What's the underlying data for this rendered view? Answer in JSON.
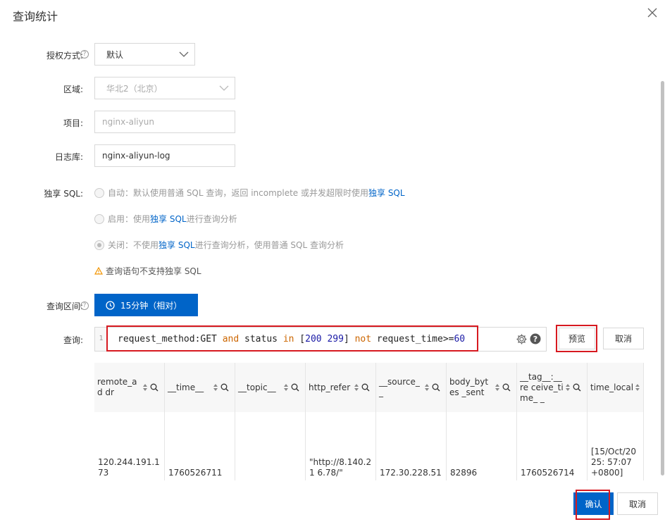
{
  "dialog": {
    "title": "查询统计"
  },
  "form": {
    "auth_label": "授权方式:",
    "auth_value": "默认",
    "region_label": "区域:",
    "region_value": "华北2（北京）",
    "project_label": "项目:",
    "project_value": "nginx-aliyun",
    "logstore_label": "日志库:",
    "logstore_value": "nginx-aliyun-log",
    "sql_label": "独享 SQL:",
    "sql_options": [
      {
        "prefix": "自动：默认使用普通 SQL 查询，返回 incomplete 或并发超限时使用 ",
        "link": "独享 SQL",
        "suffix": "",
        "checked": false
      },
      {
        "prefix": "启用：使用 ",
        "link": "独享 SQL",
        "suffix": " 进行查询分析",
        "checked": false
      },
      {
        "prefix": "关闭：不使用 ",
        "link": "独享 SQL",
        "suffix": " 进行查询分析，使用普通 SQL 查询分析",
        "checked": true
      }
    ],
    "warning": "查询语句不支持独享 SQL",
    "range_label": "查询区间:",
    "range_value": "15分钟（相对）",
    "query_label": "查询:",
    "query_line_no": "1",
    "query_tokens": [
      {
        "t": "request_method:GET ",
        "c": "plain"
      },
      {
        "t": "and",
        "c": "kw"
      },
      {
        "t": " status ",
        "c": "plain"
      },
      {
        "t": "in",
        "c": "kw"
      },
      {
        "t": " [",
        "c": "plain"
      },
      {
        "t": "200",
        "c": "num"
      },
      {
        "t": " ",
        "c": "plain"
      },
      {
        "t": "299",
        "c": "num"
      },
      {
        "t": "] ",
        "c": "plain"
      },
      {
        "t": "not",
        "c": "kw"
      },
      {
        "t": " request_time>=",
        "c": "plain"
      },
      {
        "t": "60",
        "c": "num"
      }
    ],
    "preview_label": "预览",
    "cancel_label": "取消"
  },
  "table": {
    "columns": [
      {
        "label": "remote_ad dr",
        "width": 100
      },
      {
        "label": "__time__",
        "width": 100
      },
      {
        "label": "__topic__",
        "width": 100
      },
      {
        "label": "http_refer",
        "width": 100
      },
      {
        "label": "__source__",
        "width": 100
      },
      {
        "label": "body_bytes _sent",
        "width": 100
      },
      {
        "label": "__tag__:__re ceive_time_ _",
        "width": 100
      },
      {
        "label": "time_local",
        "width": 80
      }
    ],
    "rows": [
      [
        "120.244.191.173",
        "1760526711",
        "",
        "\"http://8.140.21 6.78/\"",
        "172.30.228.51",
        "82896",
        "1760526714",
        "[15/Oct/2025: 57:07 +0800]"
      ]
    ]
  },
  "footer": {
    "confirm_label": "确认",
    "cancel_label": "取消"
  },
  "colors": {
    "primary": "#0064c8",
    "highlight": "#d71920"
  }
}
